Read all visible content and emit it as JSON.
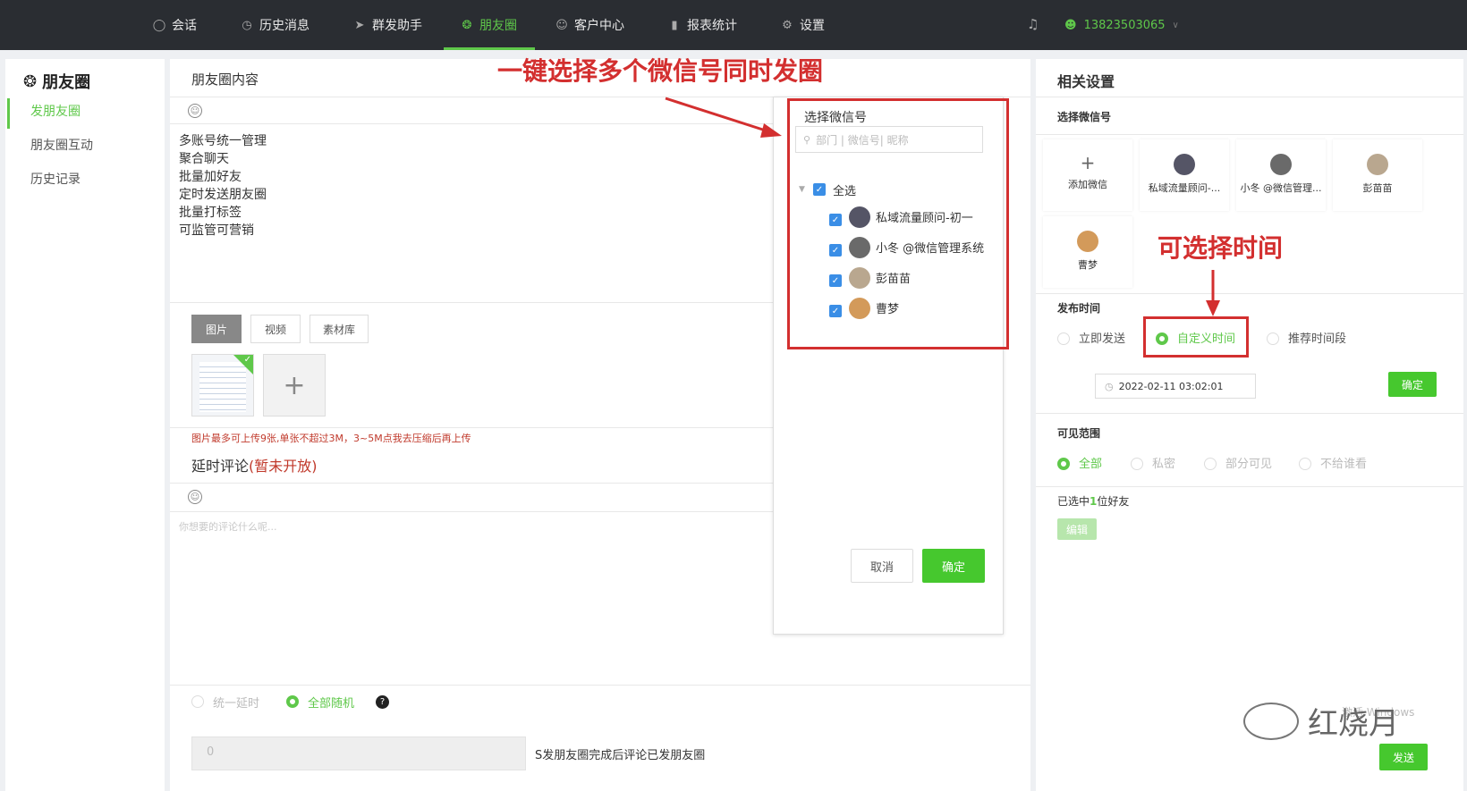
{
  "nav": {
    "items": [
      {
        "label": "会话",
        "icon": "chat-icon"
      },
      {
        "label": "历史消息",
        "icon": "clock-icon"
      },
      {
        "label": "群发助手",
        "icon": "send-icon"
      },
      {
        "label": "朋友圈",
        "icon": "moments-icon"
      },
      {
        "label": "客户中心",
        "icon": "user-icon"
      },
      {
        "label": "报表统计",
        "icon": "chart-icon"
      },
      {
        "label": "设置",
        "icon": "gear-icon"
      }
    ],
    "active_index": 3,
    "user_phone": "13823503065"
  },
  "sidebar": {
    "title": "朋友圈",
    "items": [
      {
        "label": "发朋友圈",
        "active": true
      },
      {
        "label": "朋友圈互动",
        "active": false
      },
      {
        "label": "历史记录",
        "active": false
      }
    ]
  },
  "main": {
    "title": "朋友圈内容",
    "content_lines": [
      "多账号统一管理",
      "聚合聊天",
      "批量加好友",
      "定时发送朋友圈",
      "批量打标签",
      "可监管可营销"
    ],
    "media_tabs": [
      "图片",
      "视频",
      "素材库"
    ],
    "upload_note": "图片最多可上传9张,单张不超过3M，3~5M点我去压缩后再上传",
    "delay_title": "延时评论",
    "delay_status": "(暂未开放)",
    "comment_placeholder": "你想要的评论什么呢...",
    "delay_options": [
      {
        "label": "统一延时",
        "selected": false
      },
      {
        "label": "全部随机",
        "selected": true
      }
    ],
    "delay_value": "0",
    "delay_suffix": "S发朋友圈完成后评论已发朋友圈"
  },
  "selector": {
    "title": "选择微信号",
    "search_placeholder": "部门 | 微信号| 昵称",
    "select_all": "全选",
    "accounts": [
      "私域流量顾问-初一",
      "小冬 @微信管理系统",
      "彭苗苗",
      "曹梦"
    ],
    "cancel_label": "取消",
    "confirm_label": "确定"
  },
  "annotations": {
    "top": "一键选择多个微信号同时发圈",
    "time": "可选择时间"
  },
  "right": {
    "title": "相关设置",
    "select_wechat_label": "选择微信号",
    "add_wechat": "添加微信",
    "accounts": [
      "私域流量顾问-...",
      "小冬 @微信管理...",
      "彭苗苗",
      "曹梦"
    ],
    "publish_time_label": "发布时间",
    "publish_options": [
      {
        "label": "立即发送",
        "selected": false
      },
      {
        "label": "自定义时间",
        "selected": true
      },
      {
        "label": "推荐时间段",
        "selected": false
      }
    ],
    "datetime_value": "2022-02-11 03:02:01",
    "confirm_label": "确定",
    "visibility_label": "可见范围",
    "visibility_options": [
      {
        "label": "全部",
        "selected": true
      },
      {
        "label": "私密",
        "selected": false
      },
      {
        "label": "部分可见",
        "selected": false
      },
      {
        "label": "不给谁看",
        "selected": false
      }
    ],
    "selected_prefix": "已选中",
    "selected_count": "1",
    "selected_suffix": "位好友",
    "edit_label": "编辑",
    "send_label": "发送"
  },
  "watermark": {
    "brand": "红烧月",
    "windows_text": "激活 Windows"
  },
  "colors": {
    "accent_green": "#5fc84a",
    "topbar": "#2a2d32",
    "annotation_red": "#d32f2f",
    "checkbox_blue": "#3a8ee6"
  }
}
